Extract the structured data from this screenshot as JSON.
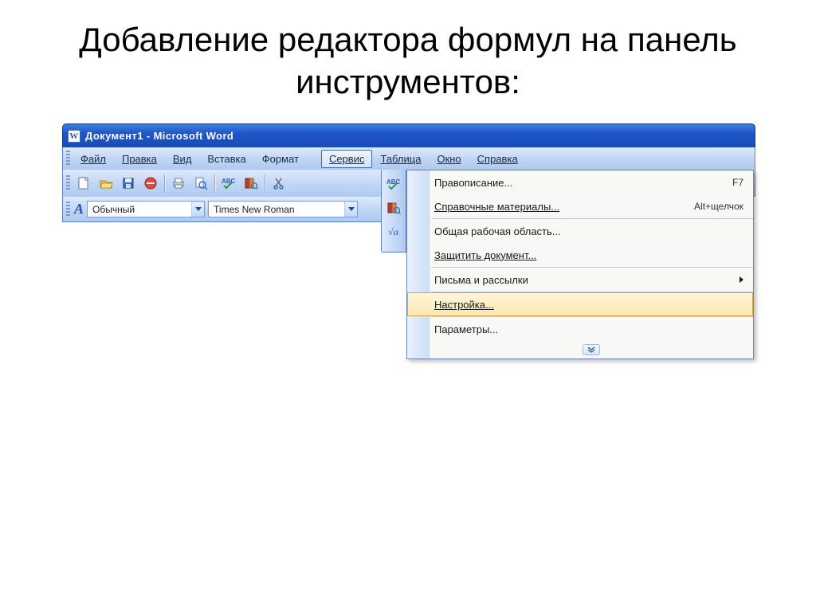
{
  "slide_title": "Добавление редактора формул на панель инструментов:",
  "titlebar": {
    "text": "Документ1 - Microsoft Word"
  },
  "menubar": {
    "file": "Файл",
    "edit": "Правка",
    "view": "Вид",
    "insert": "Вставка",
    "format": "Формат",
    "tools": "Сервис",
    "table": "Таблица",
    "window": "Окно",
    "help": "Справка"
  },
  "formatbar": {
    "style": "Обычный",
    "font": "Times New Roman"
  },
  "dropdown": {
    "spelling": {
      "label": "Правописание...",
      "shortcut": "F7"
    },
    "research": {
      "label": "Справочные материалы...",
      "shortcut": "Alt+щелчок"
    },
    "shared": "Общая рабочая область...",
    "protect": "Защитить документ...",
    "letters": "Письма и рассылки",
    "customize": "Настройка...",
    "options": "Параметры..."
  }
}
